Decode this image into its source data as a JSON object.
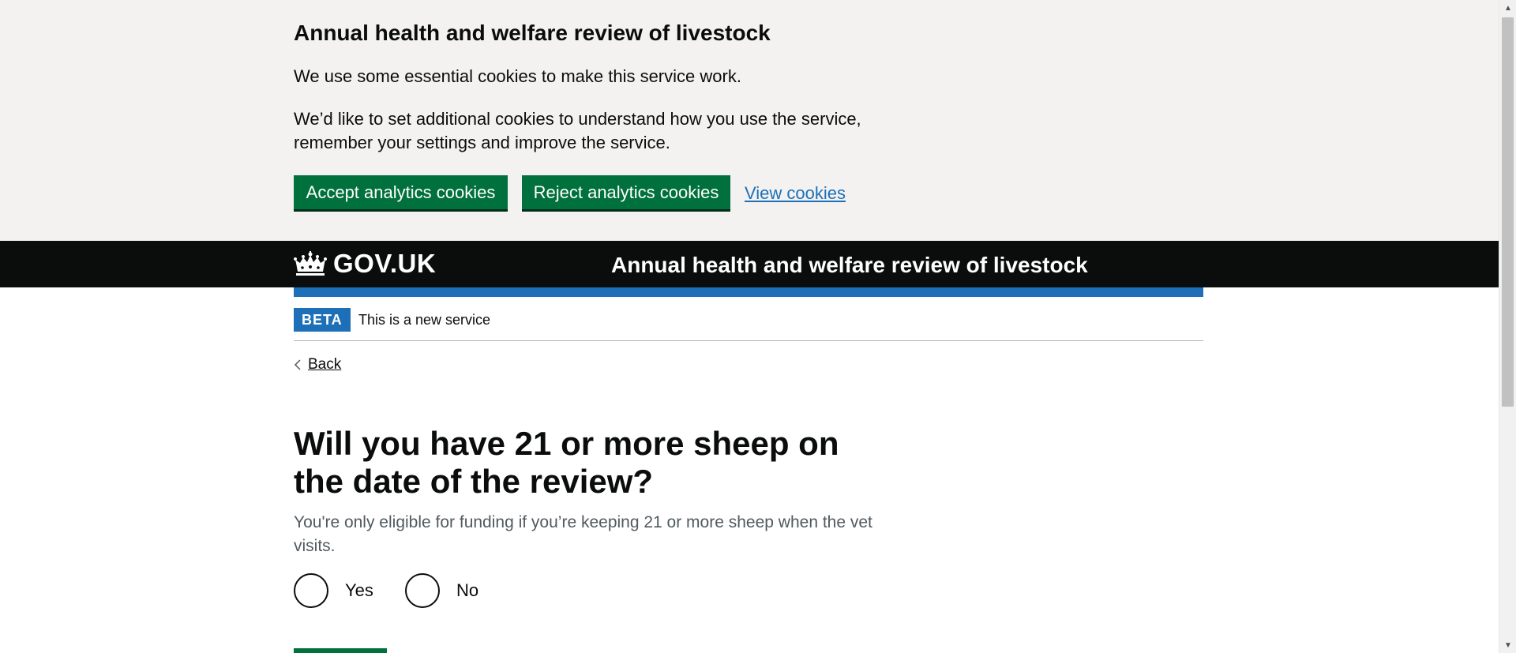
{
  "cookie_banner": {
    "title": "Annual health and welfare review of livestock",
    "paragraph_1": "We use some essential cookies to make this service work.",
    "paragraph_2": "We’d like to set additional cookies to understand how you use the service, remember your settings and improve the service.",
    "accept_label": "Accept analytics cookies",
    "reject_label": "Reject analytics cookies",
    "view_label": "View cookies"
  },
  "header": {
    "logo_text": "GOV.UK",
    "service_name": "Annual health and welfare review of livestock"
  },
  "phase_banner": {
    "tag": "BETA",
    "text": "This is a new service"
  },
  "back_link": {
    "label": "Back"
  },
  "question": {
    "heading": "Will you have 21 or more sheep on the date of the review?",
    "hint": "You're only eligible for funding if you’re keeping 21 or more sheep when the vet visits.",
    "options": [
      {
        "label": "Yes",
        "selected": false
      },
      {
        "label": "No",
        "selected": false
      }
    ]
  },
  "colors": {
    "banner_bg": "#f3f2f1",
    "button_green": "#00703c",
    "header_black": "#0b0c0c",
    "brand_blue": "#1d70b8",
    "link_blue": "#1d70b8",
    "hint_grey": "#505a5f"
  },
  "icons": {
    "logo": "crown-icon",
    "back": "chevron-left-icon"
  }
}
